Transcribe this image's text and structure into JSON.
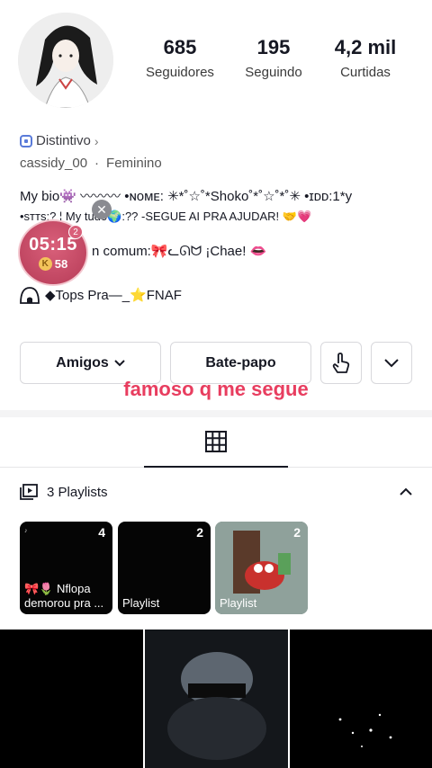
{
  "profile": {
    "stats": [
      {
        "value": "685",
        "label": "Seguidores"
      },
      {
        "value": "195",
        "label": "Seguindo"
      },
      {
        "value": "4,2 mil",
        "label": "Curtidas"
      }
    ],
    "badge_label": "Distintivo",
    "username": "cassidy_00",
    "gender": "Feminino",
    "bio_line1": "My bio👾 〰〰〰 •ɴᴏᴍᴇ: ✳︎*˚☆˚*Shoko˚*˚☆˚*˚✳︎ •ɪᴅᴅ:1*y",
    "bio_line2": "•sᴛᴛs:? ¦ My tudo🌍:?? -SEGUE AI PRA AJUDAR! 🤝💗",
    "bio_line3": "n comum:🎀ᓚᘏᗢ ¡Chae! 👄",
    "bio_line4": "◆Tops Pra—_⭐FNAF"
  },
  "timer": {
    "time": "05:15",
    "coins": "58",
    "coin_letter": "K",
    "badge_count": "2"
  },
  "buttons": {
    "friends": "Amigos",
    "chat": "Bate-papo"
  },
  "overlay_text": "famoso q me segue",
  "playlists_section": {
    "header": "3 Playlists",
    "items": [
      {
        "count": "4",
        "name": "🎀🌷 Nflopa demorou pra ..."
      },
      {
        "count": "2",
        "name": "Playlist"
      },
      {
        "count": "2",
        "name": "Playlist"
      }
    ]
  },
  "colors": {
    "accent": "#e83d5f",
    "badge": "#5a7bd9",
    "timer": "#c94a66"
  }
}
